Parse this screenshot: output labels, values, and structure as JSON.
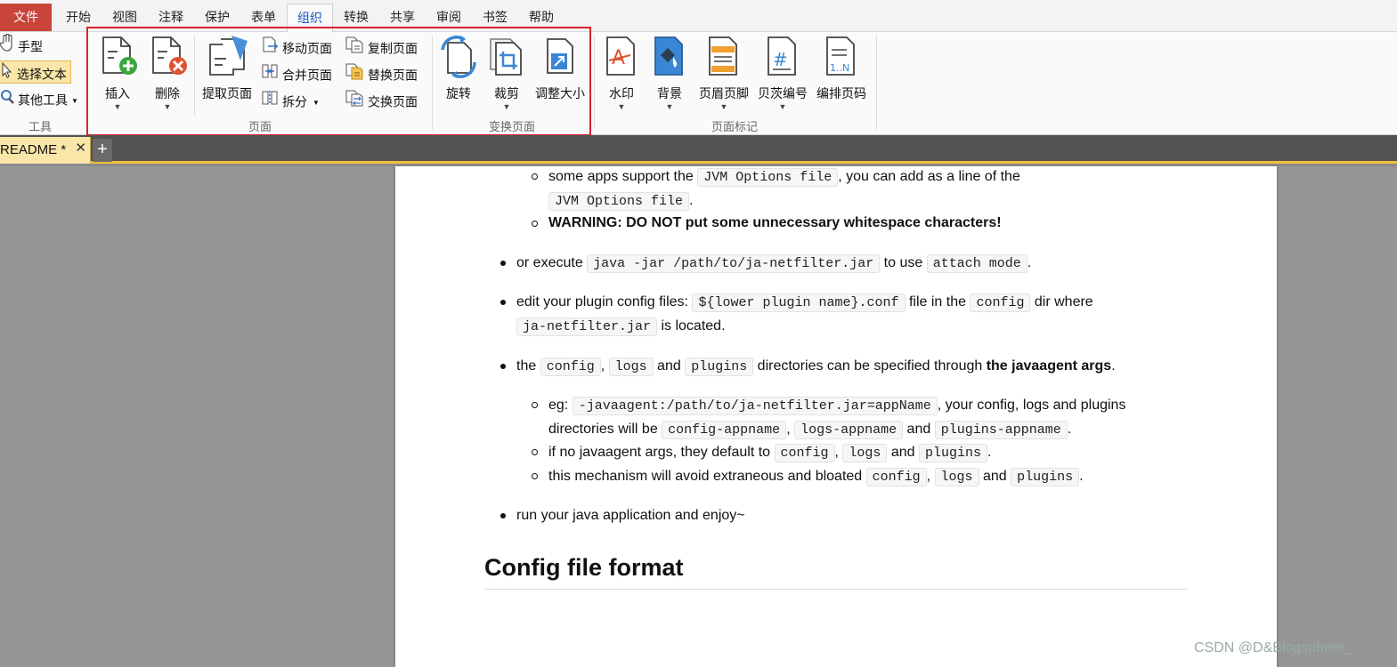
{
  "menu": {
    "file": "文件",
    "tabs": [
      "开始",
      "视图",
      "注释",
      "保护",
      "表单",
      "组织",
      "转换",
      "共享",
      "审阅",
      "书签",
      "帮助"
    ],
    "active_tab": "组织"
  },
  "tools_group": {
    "hand": "手型",
    "select_text": "选择文本",
    "other_tools": "其他工具",
    "label": "工具"
  },
  "pages_group": {
    "insert": "插入",
    "delete": "删除",
    "extract": "提取页面",
    "move": "移动页面",
    "merge": "合并页面",
    "split": "拆分",
    "copy": "复制页面",
    "replace": "替换页面",
    "swap": "交换页面",
    "label": "页面"
  },
  "transform_group": {
    "rotate": "旋转",
    "crop": "裁剪",
    "resize": "调整大小",
    "label": "变换页面"
  },
  "marks_group": {
    "watermark": "水印",
    "background": "背景",
    "header_footer": "页眉页脚",
    "bates": "贝茨编号",
    "page_number": "编排页码",
    "label": "页面标记"
  },
  "tab": {
    "name": "README *",
    "close": "✕",
    "new": "+"
  },
  "doc": {
    "l1": {
      "a": "some apps support the ",
      "c1": "JVM Options file",
      "b": ", you can add as a line of the"
    },
    "l2": {
      "c1": "JVM Options file",
      "b": "."
    },
    "l3": "WARNING: DO NOT put some unnecessary whitespace characters!",
    "l4": {
      "a": "or execute ",
      "c1": "java -jar /path/to/ja-netfilter.jar",
      "b": " to use ",
      "c2": "attach mode",
      "c": "."
    },
    "l5": {
      "a": "edit your plugin config files: ",
      "c1": "${lower plugin name}.conf",
      "b": " file in the ",
      "c2": "config",
      "c": " dir where"
    },
    "l6": {
      "c1": "ja-netfilter.jar",
      "b": " is located."
    },
    "l7": {
      "a": "the ",
      "c1": "config",
      "b": ", ",
      "c2": "logs",
      "c": " and ",
      "c3": "plugins",
      "d": " directories can be specified through ",
      "e": "the javaagent args",
      "f": "."
    },
    "l8": {
      "a": "eg: ",
      "c1": "-javaagent:/path/to/ja-netfilter.jar=appName",
      "b": ", your config, logs and plugins"
    },
    "l9": {
      "a": "directories will be ",
      "c1": "config-appname",
      "b": ", ",
      "c2": "logs-appname",
      "c": " and ",
      "c3": "plugins-appname",
      "d": "."
    },
    "l10": {
      "a": "if no javaagent args, they default to ",
      "c1": "config",
      "b": ", ",
      "c2": "logs",
      "c": " and ",
      "c3": "plugins",
      "d": "."
    },
    "l11": {
      "a": "this mechanism will avoid extraneous and bloated ",
      "c1": "config",
      "b": ", ",
      "c2": "logs",
      "c": " and ",
      "c3": "plugins",
      "d": "."
    },
    "l12": "run your java application and enjoy~",
    "heading": "Config file format"
  },
  "watermark": "CSDN @D&Blogsphere_",
  "colors": {
    "accent": "#1a55b8",
    "file_red": "#c9443b",
    "highlight_box": "#d8222d",
    "tab_yellow": "#fbe6a9"
  }
}
